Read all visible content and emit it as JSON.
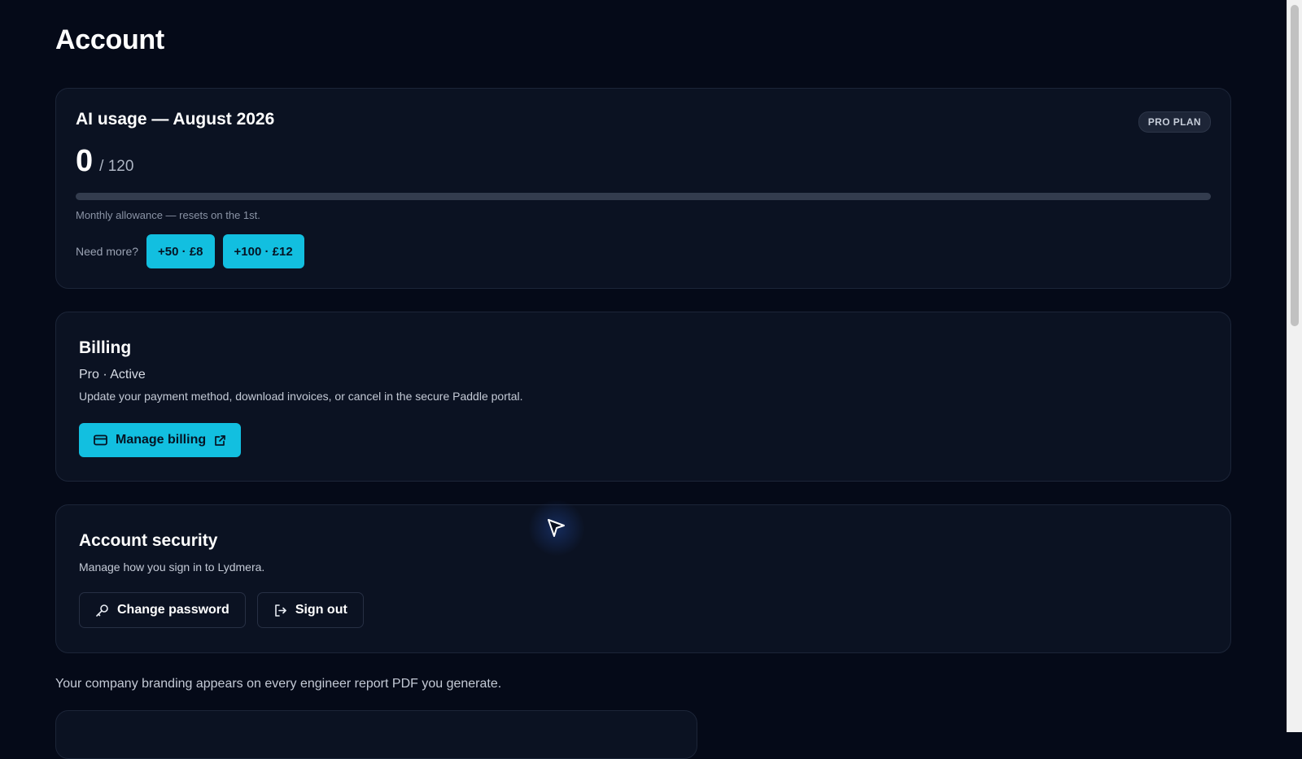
{
  "page": {
    "title": "Account"
  },
  "usage": {
    "title": "AI usage — August 2026",
    "badge": "PRO PLAN",
    "used": "0",
    "limit": "/ 120",
    "progress_fraction": 0,
    "note": "Monthly allowance — resets on the 1st.",
    "need_more_label": "Need more?",
    "topups": [
      {
        "label": "+50 · £8"
      },
      {
        "label": "+100 · £12"
      }
    ]
  },
  "billing": {
    "title": "Billing",
    "status": "Pro · Active",
    "description": "Update your payment method, download invoices, or cancel in the secure Paddle portal.",
    "manage_label": "Manage billing"
  },
  "security": {
    "title": "Account security",
    "description": "Manage how you sign in to Lydmera.",
    "change_password_label": "Change password",
    "sign_out_label": "Sign out"
  },
  "branding": {
    "note": "Your company branding appears on every engineer report PDF you generate."
  },
  "theme": {
    "background": "#050a18",
    "card": "#0b1222",
    "accent": "#12bfe0",
    "icons": [
      "credit-card-icon",
      "external-link-icon",
      "key-icon",
      "sign-out-icon",
      "cursor-icon"
    ]
  }
}
